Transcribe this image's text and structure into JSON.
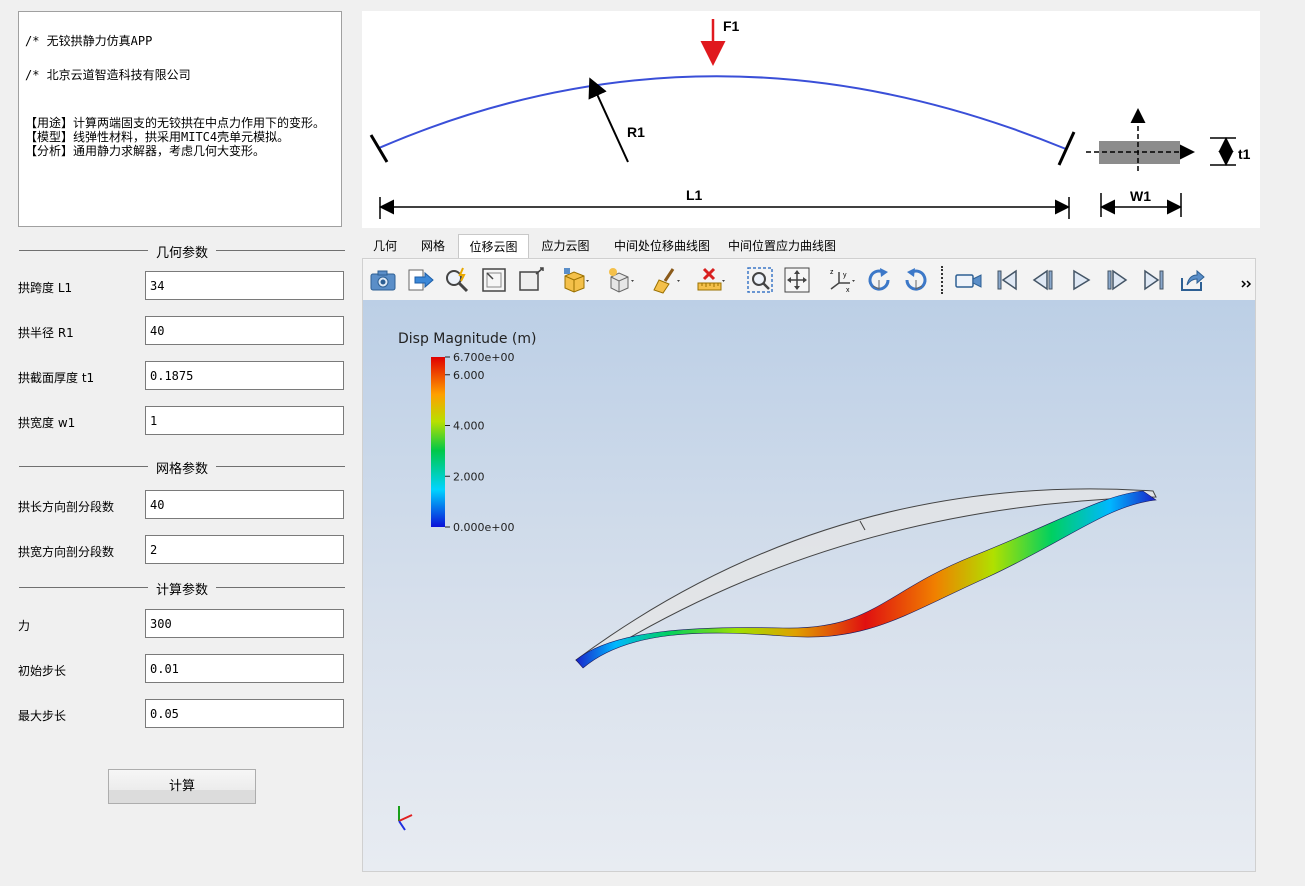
{
  "description": {
    "line1": "/* 无铰拱静力仿真APP",
    "line2": "/* 北京云道智造科技有限公司",
    "usage": "【用途】计算两端固支的无铰拱在中点力作用下的变形。",
    "model": "【模型】线弹性材料，拱采用MITC4壳单元模拟。",
    "analysis": "【分析】通用静力求解器，考虑几何大变形。"
  },
  "sections": {
    "geometry": "几何参数",
    "mesh": "网格参数",
    "compute": "计算参数"
  },
  "params": {
    "span": {
      "label": "拱跨度 L1",
      "value": "34"
    },
    "radius": {
      "label": "拱半径 R1",
      "value": "40"
    },
    "thickness": {
      "label": "拱截面厚度 t1",
      "value": "0.1875"
    },
    "width": {
      "label": "拱宽度 w1",
      "value": "1"
    },
    "len_div": {
      "label": "拱长方向剖分段数",
      "value": "40"
    },
    "wid_div": {
      "label": "拱宽方向剖分段数",
      "value": "2"
    },
    "force": {
      "label": "力",
      "value": "300"
    },
    "init_step": {
      "label": "初始步长",
      "value": "0.01"
    },
    "max_step": {
      "label": "最大步长",
      "value": "0.05"
    }
  },
  "calc_button": "计算",
  "diagram": {
    "f1": "F1",
    "r1": "R1",
    "l1": "L1",
    "w1": "W1",
    "t1": "t1"
  },
  "tabs": [
    {
      "label": "几何"
    },
    {
      "label": "网格"
    },
    {
      "label": "位移云图",
      "active": true
    },
    {
      "label": "应力云图"
    },
    {
      "label": "中间处位移曲线图"
    },
    {
      "label": "中间位置应力曲线图"
    }
  ],
  "toolbar_icons": [
    "camera-icon",
    "export-icon",
    "probe-icon",
    "zoom-fit-icon",
    "reset-view-icon",
    "box-dropdown-icon",
    "box-settings-dropdown-icon",
    "clear-brush-icon",
    "ruler-delete-icon",
    "zoom-box-icon",
    "pan-icon",
    "axes-orient-icon",
    "rotate-cw-icon",
    "rotate-ccw-icon",
    "video-camera-icon",
    "first-frame-icon",
    "prev-frame-icon",
    "play-icon",
    "next-frame-icon",
    "last-frame-icon",
    "export-animation-icon",
    "more-icon"
  ],
  "legend": {
    "title": "Disp Magnitude (m)",
    "max": "6.700e+00",
    "ticks": [
      "6.000",
      "4.000",
      "2.000"
    ],
    "min": "0.000e+00",
    "range": [
      0,
      6.7
    ],
    "tick_values": [
      6,
      4,
      2
    ]
  },
  "colors": {
    "arch_line": "#3a4fd8",
    "force_arrow": "#e0191e",
    "accent_bg": "#bccfe6"
  }
}
